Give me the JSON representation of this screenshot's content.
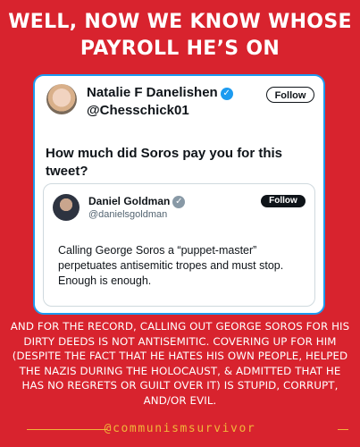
{
  "headline": {
    "line1": "WELL, NOW WE KNOW WHOSE",
    "line2": "PAYROLL HE’S ON"
  },
  "tweet": {
    "name": "Natalie F Danelishen",
    "handle": "@Chesschick01",
    "follow_label": "Follow",
    "text": "How much did Soros pay you for this tweet?",
    "verified_icon": "verified-badge-icon"
  },
  "quoted_tweet": {
    "name": "Daniel Goldman",
    "handle": "@danielsgoldman",
    "follow_label": "Follow",
    "text": "Calling George Soros a “puppet-master” perpetuates antisemitic tropes and must stop. Enough is enough."
  },
  "body_text": "AND FOR THE RECORD, CALLING OUT  GEORGE SOROS FOR HIS DIRTY DEEDS IS NOT ANTISEMITIC. COVERING UP FOR HIM (DESPITE THE FACT THAT HE HATES HIS OWN PEOPLE, HELPED THE NAZIS DURING THE HOLOCAUST, & ADMITTED THAT HE HAS NO REGRETS OR GUILT OVER IT) IS STUPID, CORRUPT, AND/OR EVIL.",
  "footer": {
    "handle": "@communismsurvivor"
  },
  "colors": {
    "background": "#d8232e",
    "accent": "#f0b63a",
    "tweet_border": "#1d9bf0"
  }
}
